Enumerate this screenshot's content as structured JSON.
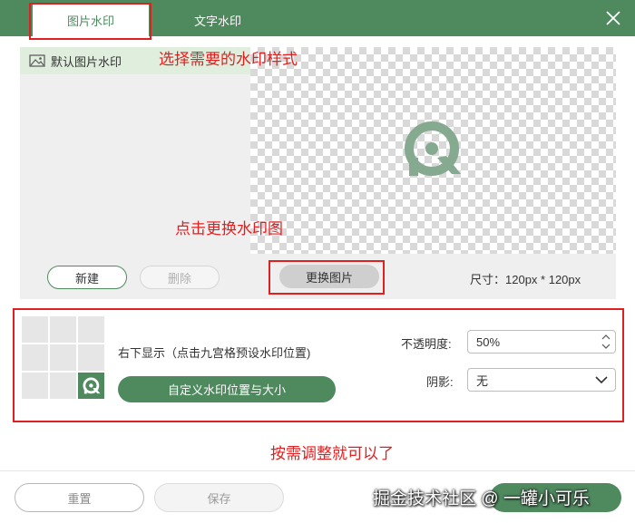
{
  "tabs": [
    {
      "label": "图片水印",
      "active": true
    },
    {
      "label": "文字水印",
      "active": false
    }
  ],
  "annotations": {
    "choose_style": "选择需要的水印样式",
    "click_change": "点击更换水印图",
    "adjust": "按需调整就可以了"
  },
  "watermark_list": {
    "items": [
      {
        "label": "默认图片水印",
        "icon": "image-icon",
        "selected": true
      }
    ],
    "new_label": "新建",
    "delete_label": "删除"
  },
  "preview": {
    "change_image_label": "更换图片",
    "size_label": "尺寸：",
    "size_value": "120px * 120px"
  },
  "position": {
    "grid_selected": "bottom-right",
    "description": "右下显示（点击九宫格预设水印位置)",
    "custom_label": "自定义水印位置与大小"
  },
  "opacity": {
    "label": "不透明度:",
    "value": "50%"
  },
  "shadow": {
    "label": "阴影:",
    "value": "无"
  },
  "footer": {
    "reset_label": "重置",
    "save_label": "保存"
  },
  "site_watermark": "掘金技术社区 @ 一罐小可乐",
  "colors": {
    "accent": "#4f8a5f",
    "annotation": "#e02020",
    "selected_row": "#dfeedd"
  }
}
